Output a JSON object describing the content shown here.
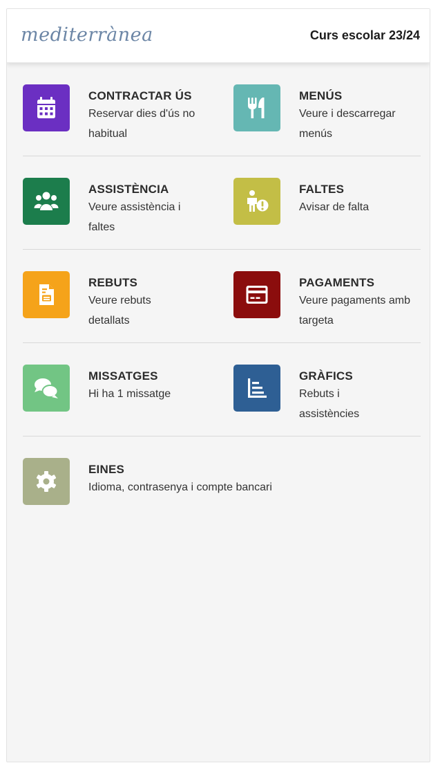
{
  "header": {
    "logo_text": "mediterrànea",
    "school_year": "Curs escolar 23/24"
  },
  "menu": [
    {
      "title": "CONTRACTAR ÚS",
      "desc": "Reservar dies d'ús no habitual",
      "icon": "calendar-icon",
      "color": "#6b2fc2"
    },
    {
      "title": "MENÚS",
      "desc": "Veure i descarregar menús",
      "icon": "utensils-icon",
      "color": "#65b7b3"
    },
    {
      "title": "ASSISTÈNCIA",
      "desc": "Veure assistència i faltes",
      "icon": "users-icon",
      "color": "#1c7d4c"
    },
    {
      "title": "FALTES",
      "desc": "Avisar de falta",
      "icon": "person-alert-icon",
      "color": "#c3be46"
    },
    {
      "title": "REBUTS",
      "desc": "Veure rebuts detallats",
      "icon": "receipt-icon",
      "color": "#f5a31a"
    },
    {
      "title": "PAGAMENTS",
      "desc": "Veure pagaments amb targeta",
      "icon": "credit-card-icon",
      "color": "#8b0d0d"
    },
    {
      "title": "MISSATGES",
      "desc": "Hi ha 1 missatge",
      "icon": "chat-icon",
      "color": "#72c584"
    },
    {
      "title": "GRÀFICS",
      "desc": "Rebuts i assistències",
      "icon": "chart-icon",
      "color": "#2e5f94"
    },
    {
      "title": "EINES",
      "desc": "Idioma, contrasenya i compte bancari",
      "icon": "gear-icon",
      "color": "#a9b08a"
    }
  ]
}
